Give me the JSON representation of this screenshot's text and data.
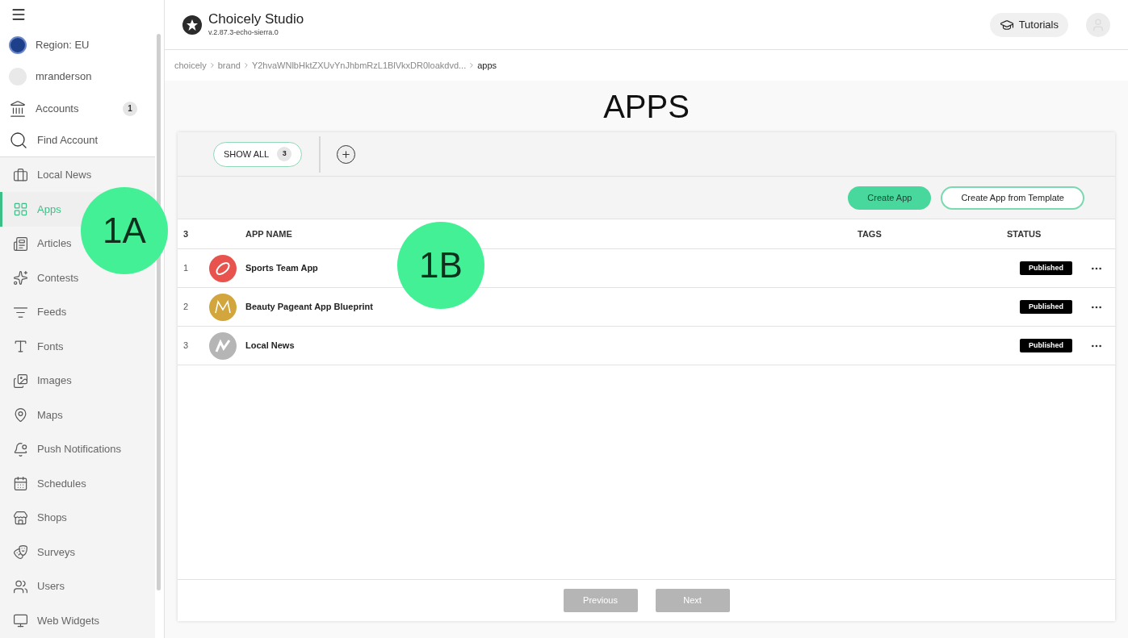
{
  "sidebar": {
    "top_items": [
      {
        "label": "Region: EU",
        "kind": "region"
      },
      {
        "label": "mranderson",
        "kind": "user"
      },
      {
        "label": "Accounts",
        "kind": "accounts",
        "badge": "1"
      },
      {
        "label": "Find Account",
        "kind": "search"
      }
    ],
    "items": [
      {
        "label": "Local News",
        "selected": false
      },
      {
        "label": "Apps",
        "selected": true
      },
      {
        "label": "Articles",
        "selected": false
      },
      {
        "label": "Contests",
        "selected": false
      },
      {
        "label": "Feeds",
        "selected": false
      },
      {
        "label": "Fonts",
        "selected": false
      },
      {
        "label": "Images",
        "selected": false
      },
      {
        "label": "Maps",
        "selected": false
      },
      {
        "label": "Push Notifications",
        "selected": false
      },
      {
        "label": "Schedules",
        "selected": false
      },
      {
        "label": "Shops",
        "selected": false
      },
      {
        "label": "Surveys",
        "selected": false
      },
      {
        "label": "Users",
        "selected": false
      },
      {
        "label": "Web Widgets",
        "selected": false
      }
    ]
  },
  "header": {
    "title": "Choicely Studio",
    "version": "v.2.87.3-echo-sierra.0",
    "tutorials": "Tutorials"
  },
  "breadcrumb": [
    "choicely",
    "brand",
    "Y2hvaWNlbHktZXUvYnJhbmRzL1BlVkxDR0loakdvd...",
    "apps"
  ],
  "page_title": "APPS",
  "filters": [
    {
      "label": "SHOW ALL",
      "count": "3",
      "selected": true
    }
  ],
  "actions": {
    "primary": "Create App",
    "secondary": "Create App from Template"
  },
  "table": {
    "count": "3",
    "columns": [
      "APP NAME",
      "TAGS",
      "STATUS"
    ],
    "rows": [
      {
        "index": "1",
        "name": "Sports Team App",
        "status": "Published"
      },
      {
        "index": "2",
        "name": "Beauty Pageant App Blueprint",
        "status": "Published"
      },
      {
        "index": "3",
        "name": "Local News",
        "status": "Published"
      }
    ]
  },
  "pagination": {
    "previous": "Previous",
    "next": "Next"
  },
  "annotations": [
    {
      "label": "1A"
    },
    {
      "label": "1B"
    }
  ]
}
